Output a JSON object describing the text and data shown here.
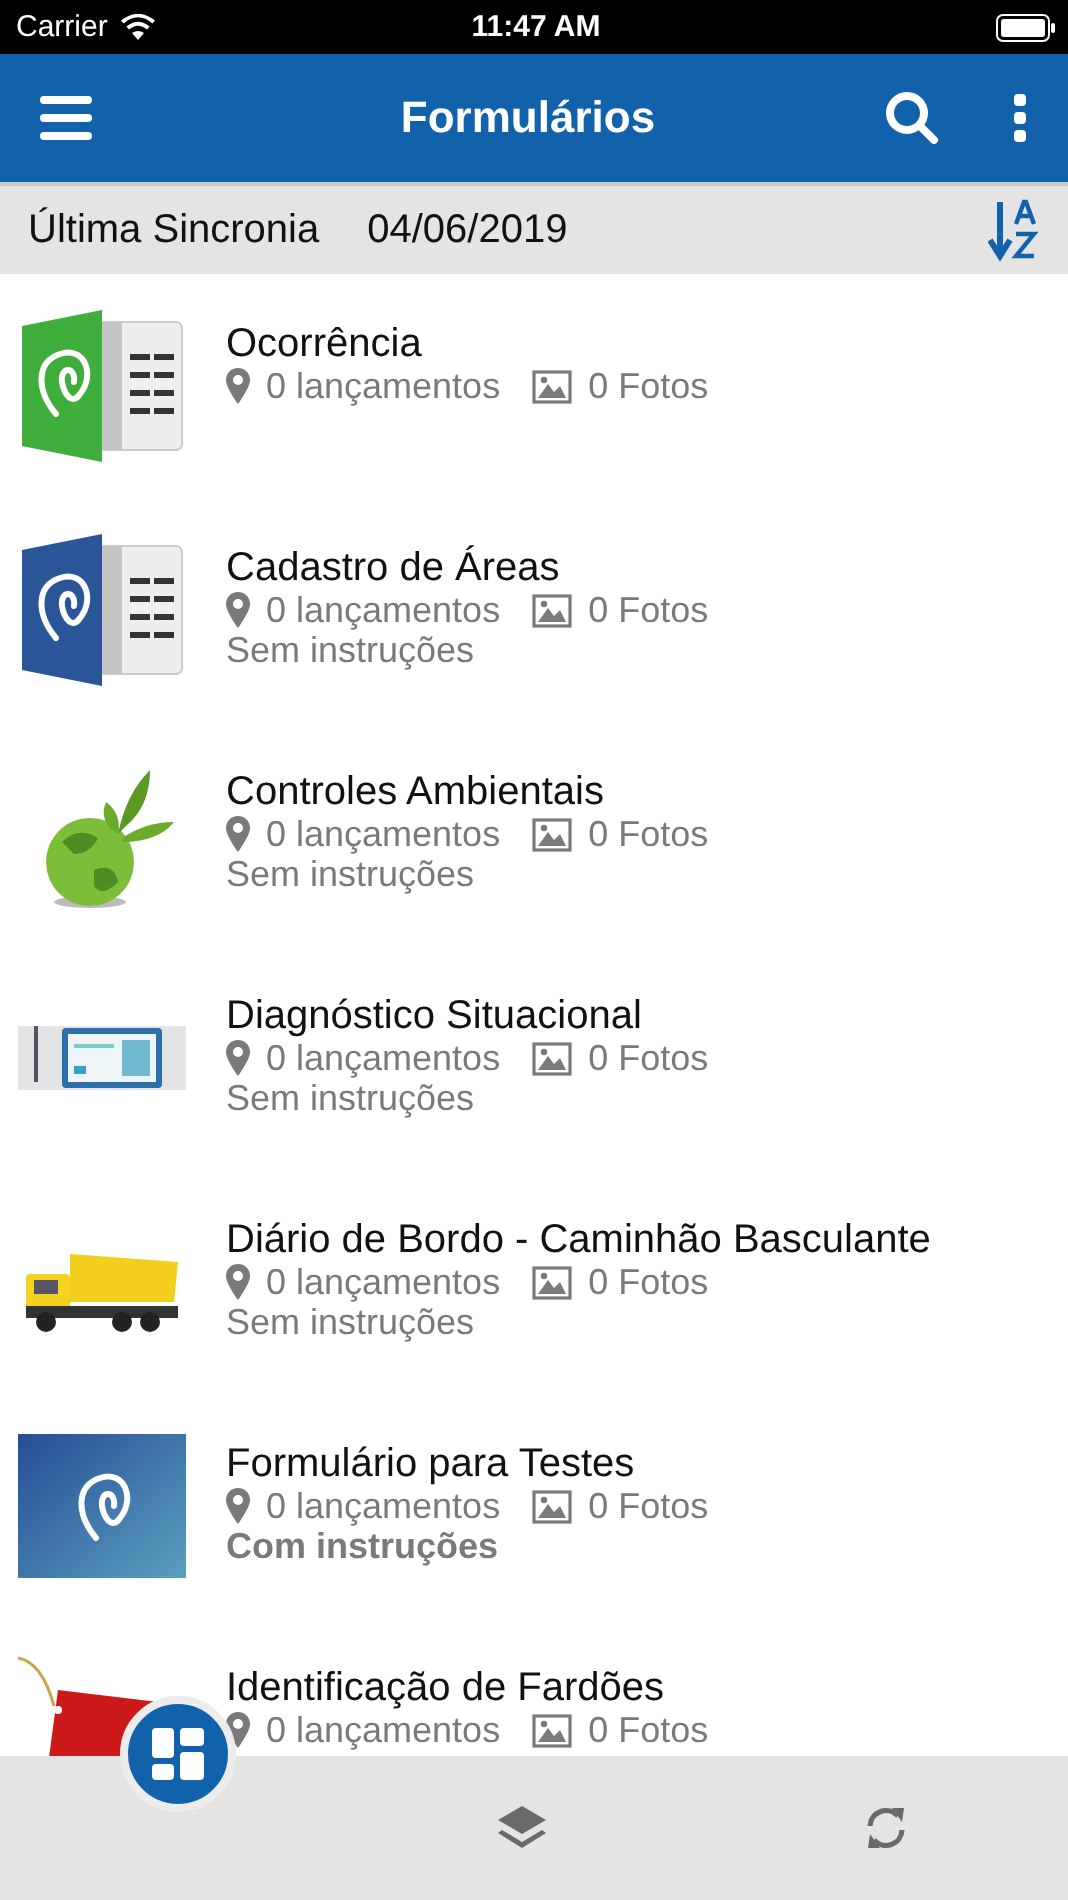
{
  "status_bar": {
    "carrier": "Carrier",
    "time": "11:47 AM"
  },
  "nav_bar": {
    "title": "Formulários"
  },
  "sync_bar": {
    "label": "Última Sincronia",
    "date": "04/06/2019"
  },
  "forms": [
    {
      "title": "Ocorrência",
      "launches": "0 lançamentos",
      "photos": "0 Fotos",
      "thumbnail": {
        "kind": "form",
        "color": "#3fae3c"
      }
    },
    {
      "title": "Cadastro de Áreas",
      "launches": "0 lançamentos",
      "photos": "0 Fotos",
      "instructions": "Sem instruções",
      "emphasized": false,
      "thumbnail": {
        "kind": "form",
        "color": "#2a5597"
      }
    },
    {
      "title": "Controles Ambientais",
      "launches": "0 lançamentos",
      "photos": "0 Fotos",
      "instructions": "Sem instruções",
      "emphasized": false,
      "thumbnail": {
        "kind": "globe"
      }
    },
    {
      "title": "Diagnóstico Situacional",
      "launches": "0 lançamentos",
      "photos": "0 Fotos",
      "instructions": "Sem instruções",
      "emphasized": false,
      "thumbnail": {
        "kind": "tablet"
      }
    },
    {
      "title": "Diário de Bordo - Caminhão Basculante",
      "launches": "0 lançamentos",
      "photos": "0 Fotos",
      "instructions": "Sem instruções",
      "emphasized": false,
      "thumbnail": {
        "kind": "truck"
      }
    },
    {
      "title": "Formulário para Testes",
      "launches": "0 lançamentos",
      "photos": "0 Fotos",
      "instructions": "Com instruções",
      "emphasized": true,
      "thumbnail": {
        "kind": "logo"
      }
    },
    {
      "title": "Identificação de Fardões",
      "launches": "0 lançamentos",
      "photos": "0 Fotos",
      "thumbnail": {
        "kind": "tag"
      }
    }
  ]
}
